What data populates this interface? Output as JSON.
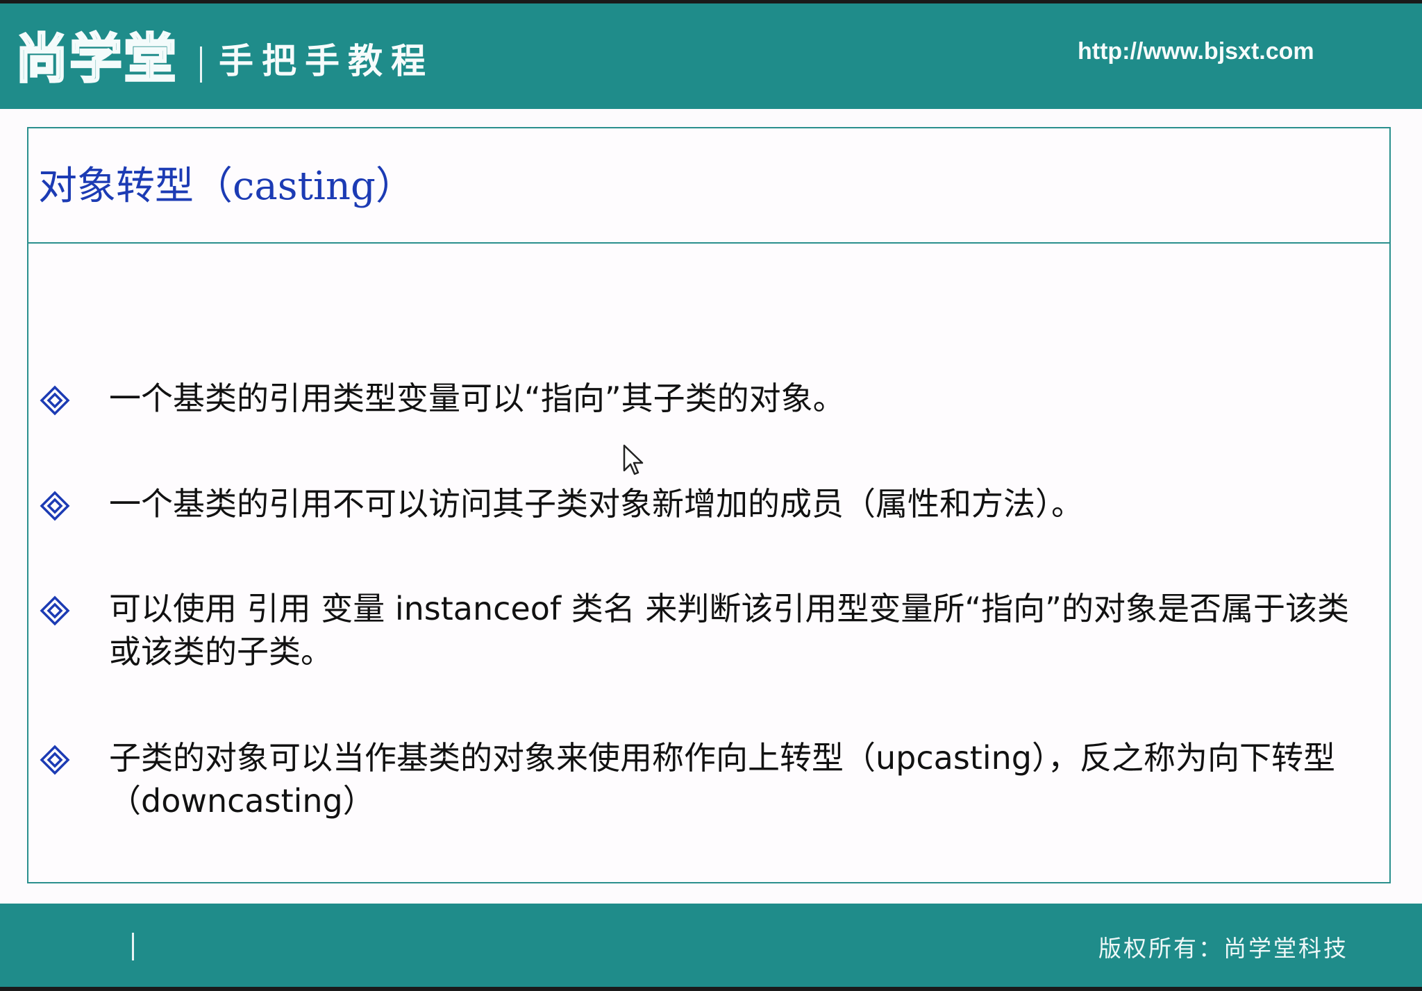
{
  "header": {
    "logo_text": "尚学堂",
    "tagline": "手把手教程",
    "url": "http://www.bjsxt.com"
  },
  "slide": {
    "title": "对象转型（casting）",
    "bullets": [
      "一个基类的引用类型变量可以“指向”其子类的对象。",
      "一个基类的引用不可以访问其子类对象新增加的成员（属性和方法）。",
      "可以使用 引用 变量 instanceof 类名 来判断该引用型变量所“指向”的对象是否属于该类或该类的子类。",
      "子类的对象可以当作基类的对象来使用称作向上转型（upcasting），反之称为向下转型（downcasting）"
    ]
  },
  "footer": {
    "copyright": "版权所有：尚学堂科技"
  },
  "icons": {
    "bullet": "diamond-bullet-icon",
    "cursor": "mouse-pointer-icon"
  },
  "colors": {
    "band": "#1f8c8a",
    "title": "#1c3bb4",
    "bullet": "#1c3bb4",
    "border": "#2a8f8d"
  }
}
